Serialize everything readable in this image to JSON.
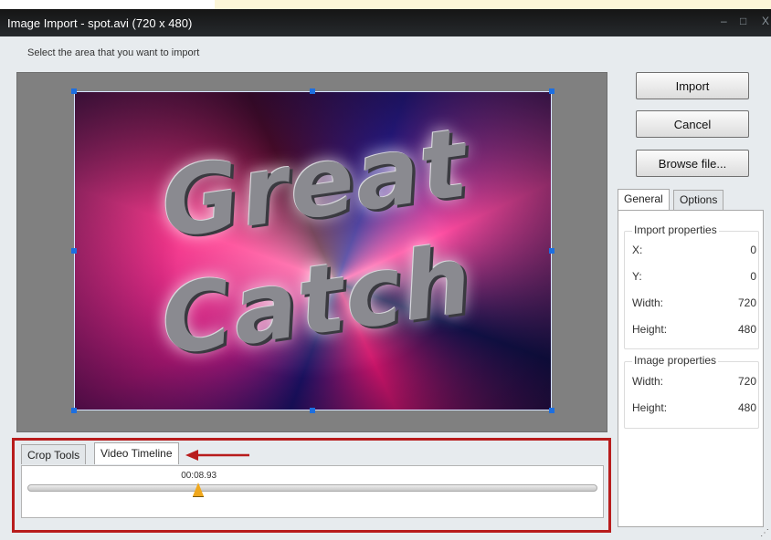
{
  "window": {
    "title": "Image Import - spot.avi  (720 x 480)",
    "controls": {
      "minimize": "–",
      "maximize": "□",
      "close": "X"
    }
  },
  "instruction": "Select the area that you want to import",
  "preview": {
    "frame_text_line1": "Great",
    "frame_text_line2": "Catch"
  },
  "buttons": {
    "import": "Import",
    "cancel": "Cancel",
    "browse": "Browse file..."
  },
  "properties": {
    "tabs": [
      "General",
      "Options"
    ],
    "active_tab": "General",
    "import_group": {
      "title": "Import properties",
      "rows": [
        {
          "label": "X:",
          "value": "0"
        },
        {
          "label": "Y:",
          "value": "0"
        },
        {
          "label": "Width:",
          "value": "720"
        },
        {
          "label": "Height:",
          "value": "480"
        }
      ]
    },
    "image_group": {
      "title": "Image properties",
      "rows": [
        {
          "label": "Width:",
          "value": "720"
        },
        {
          "label": "Height:",
          "value": "480"
        }
      ]
    }
  },
  "bottom_tabs": [
    "Crop Tools",
    "Video Timeline"
  ],
  "active_bottom_tab": "Video Timeline",
  "timeline": {
    "current_time": "00:08.93",
    "position_fraction": 0.3
  },
  "colors": {
    "highlight_border": "#b81c1c",
    "thumb": "#f0a81d",
    "crop_handle": "#1d6fe0"
  }
}
